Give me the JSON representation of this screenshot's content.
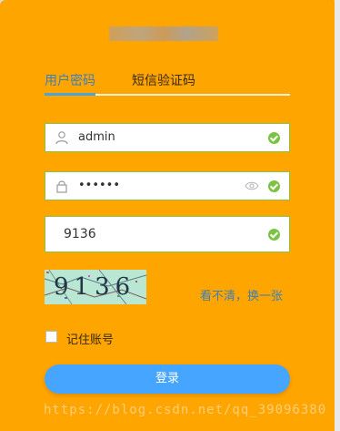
{
  "tabs": [
    {
      "label": "用户密码",
      "active": true
    },
    {
      "label": "短信验证码",
      "active": false
    }
  ],
  "username": {
    "value": "admin"
  },
  "password": {
    "value": "••••••"
  },
  "captcha": {
    "input_value": "9136",
    "image_text": "9136",
    "refresh_link": "看不清，换一张"
  },
  "remember": {
    "label": "记住账号",
    "checked": false
  },
  "login_button": {
    "label": "登录"
  },
  "watermark": "https://blog.csdn.net/qq_39096380",
  "colors": {
    "panel_bg": "#ffa500",
    "valid_border": "#8bc34a",
    "primary_button": "#46a6ff",
    "link": "#3d7fb8",
    "ok": "#7cc243"
  }
}
